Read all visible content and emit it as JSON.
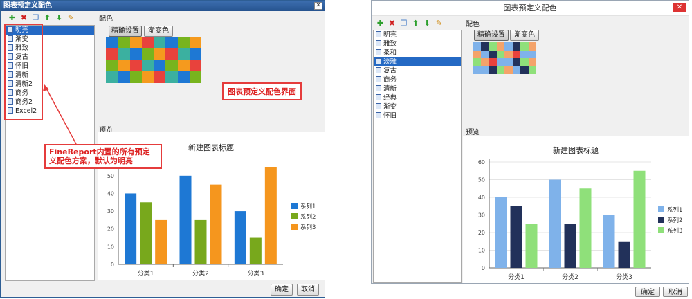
{
  "left": {
    "title": "图表预定义配色",
    "close_glyph": "✕",
    "toolbar": [
      "add-icon",
      "delete-icon",
      "copy-icon",
      "move-up-icon",
      "move-down-icon",
      "rename-icon"
    ],
    "list": [
      "明亮",
      "渐变",
      "雅致",
      "复古",
      "怀旧",
      "清新",
      "清新2",
      "商务",
      "商务2",
      "Excel2"
    ],
    "selected_index": 0,
    "section_color": "配色",
    "tab_precise": "精确设置",
    "tab_gradient": "渐变色",
    "palette_colors": [
      "#1e78d4",
      "#78b41e",
      "#f59a1e",
      "#e8423c",
      "#3bb0a0",
      "#1e78d4",
      "#78b41e",
      "#f59a1e",
      "#e8423c",
      "#3bb0a0"
    ],
    "section_preview": "预览",
    "annotation_right": "图表预定义配色界面",
    "annotation_left": "FineReport内置的所有预定义配色方案，默认为明亮",
    "ok": "确定",
    "cancel": "取消"
  },
  "right": {
    "title": "图表预定义配色",
    "close_glyph": "✕",
    "toolbar": [
      "add-icon",
      "delete-icon",
      "copy-icon",
      "move-up-icon",
      "move-down-icon",
      "rename-icon"
    ],
    "list": [
      "明亮",
      "雅致",
      "柔和",
      "淡雅",
      "复古",
      "商务",
      "清新",
      "经典",
      "渐变",
      "怀旧"
    ],
    "selected_index": 3,
    "section_color": "配色",
    "tab_precise": "精确设置",
    "tab_gradient": "渐变色",
    "palette_colors": [
      "#7fb2ea",
      "#22315a",
      "#8fe07a",
      "#f4a36a",
      "#7fb2ea",
      "#22315a",
      "#8fe07a",
      "#f4a36a",
      "#e8423c",
      "#7fb2ea"
    ],
    "section_preview": "预览",
    "ok": "确定",
    "cancel": "取消"
  },
  "chart_left": {
    "type": "bar",
    "title": "新建图表标题",
    "categories": [
      "分类1",
      "分类2",
      "分类3"
    ],
    "series": [
      {
        "name": "系列1",
        "values": [
          40,
          50,
          30
        ],
        "color": "#1e78d4"
      },
      {
        "name": "系列2",
        "values": [
          35,
          25,
          15
        ],
        "color": "#78a81c"
      },
      {
        "name": "系列3",
        "values": [
          25,
          45,
          55
        ],
        "color": "#f5961e"
      }
    ],
    "yticks": [
      0,
      10,
      20,
      30,
      40,
      50
    ],
    "ylim": [
      0,
      55
    ]
  },
  "chart_right": {
    "type": "bar",
    "title": "新建图表标题",
    "categories": [
      "分类1",
      "分类2",
      "分类3"
    ],
    "series": [
      {
        "name": "系列1",
        "values": [
          40,
          50,
          30
        ],
        "color": "#7fb2ea"
      },
      {
        "name": "系列2",
        "values": [
          35,
          25,
          15
        ],
        "color": "#22315a"
      },
      {
        "name": "系列3",
        "values": [
          25,
          45,
          55
        ],
        "color": "#8fe07a"
      }
    ],
    "yticks": [
      0,
      10,
      20,
      30,
      40,
      50,
      60
    ],
    "ylim": [
      0,
      60
    ]
  },
  "chart_data": [
    {
      "type": "bar",
      "title": "新建图表标题",
      "categories": [
        "分类1",
        "分类2",
        "分类3"
      ],
      "series": [
        {
          "name": "系列1",
          "values": [
            40,
            50,
            30
          ]
        },
        {
          "name": "系列2",
          "values": [
            35,
            25,
            15
          ]
        },
        {
          "name": "系列3",
          "values": [
            25,
            45,
            55
          ]
        }
      ],
      "ylim": [
        0,
        55
      ],
      "legend": "right"
    },
    {
      "type": "bar",
      "title": "新建图表标题",
      "categories": [
        "分类1",
        "分类2",
        "分类3"
      ],
      "series": [
        {
          "name": "系列1",
          "values": [
            40,
            50,
            30
          ]
        },
        {
          "name": "系列2",
          "values": [
            35,
            25,
            15
          ]
        },
        {
          "name": "系列3",
          "values": [
            25,
            45,
            55
          ]
        }
      ],
      "ylim": [
        0,
        60
      ],
      "legend": "right"
    }
  ]
}
